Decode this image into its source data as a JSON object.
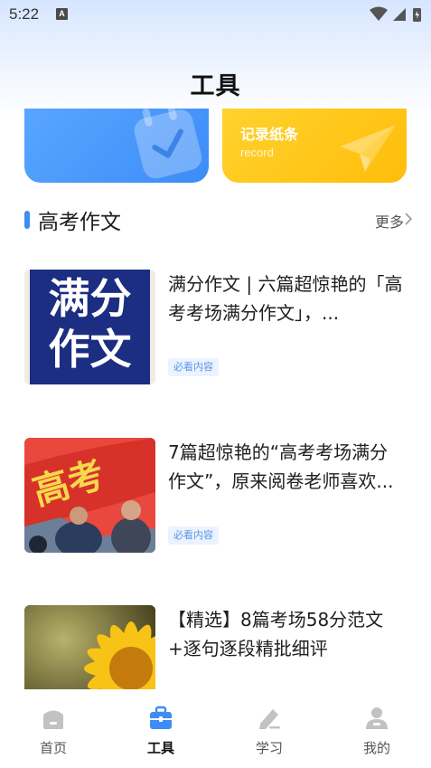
{
  "status_bar": {
    "time": "5:22",
    "notification_icon": "A"
  },
  "header": {
    "title": "工具"
  },
  "cards": [
    {
      "title": "",
      "subtitle": "",
      "icon": "calendar-check-icon",
      "color": "#4a9af9"
    },
    {
      "title": "记录纸条",
      "subtitle": "record",
      "icon": "paper-plane-icon",
      "color": "#ffc61a"
    }
  ],
  "section": {
    "title": "高考作文",
    "more_label": "更多"
  },
  "articles": [
    {
      "title": "满分作文 | 六篇超惊艳的「高考考场满分作文」，...",
      "tag": "必看内容",
      "thumb_text_1": "满分",
      "thumb_text_2": "作文"
    },
    {
      "title": "7篇超惊艳的“高考考场满分作文”，原来阅卷老师喜欢...",
      "tag": "必看内容",
      "thumb_text": "高考"
    },
    {
      "title": "【精选】8篇考场58分范文+逐句逐段精批细评",
      "tag": "",
      "thumb_text": ""
    }
  ],
  "bottom_nav": [
    {
      "label": "首页",
      "icon": "home-icon",
      "active": false
    },
    {
      "label": "工具",
      "icon": "toolbox-icon",
      "active": true
    },
    {
      "label": "学习",
      "icon": "pen-icon",
      "active": false
    },
    {
      "label": "我的",
      "icon": "profile-icon",
      "active": false
    }
  ],
  "colors": {
    "accent": "#3d8cf7",
    "tag_bg": "#eaf3ff",
    "tag_text": "#5c95e4",
    "card_yellow": "#ffc61a"
  }
}
